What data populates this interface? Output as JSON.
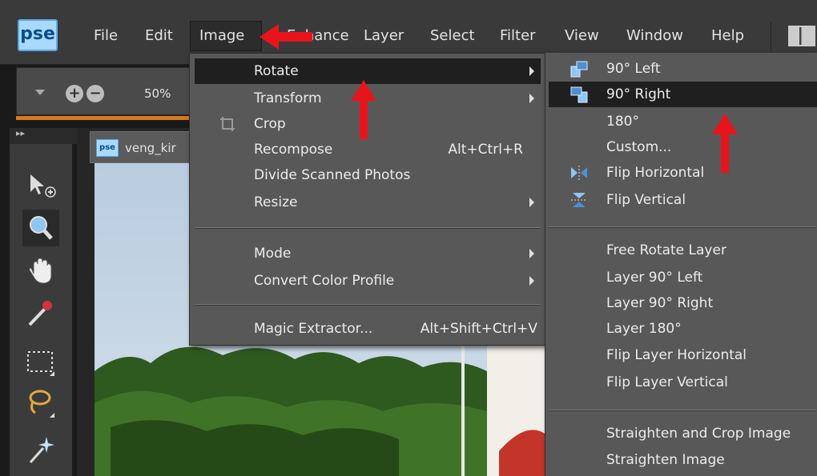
{
  "app": {
    "logo": "pse"
  },
  "menubar": {
    "items": [
      "File",
      "Edit",
      "Image",
      "Enhance",
      "Layer",
      "Select",
      "Filter",
      "View",
      "Window",
      "Help"
    ]
  },
  "options": {
    "zoom": "50%"
  },
  "document": {
    "tab_logo": "pse",
    "filename": "veng_kir"
  },
  "image_menu": {
    "items": [
      {
        "label": "Rotate",
        "submenu": true,
        "highlighted": true
      },
      {
        "label": "Transform",
        "submenu": true
      },
      {
        "label": "Crop",
        "icon": "crop-icon"
      },
      {
        "label": "Recompose",
        "shortcut": "Alt+Ctrl+R"
      },
      {
        "label": "Divide Scanned Photos"
      },
      {
        "label": "Resize",
        "submenu": true
      },
      {
        "label": "Mode",
        "submenu": true
      },
      {
        "label": "Convert Color Profile",
        "submenu": true
      },
      {
        "label": "Magic Extractor...",
        "shortcut": "Alt+Shift+Ctrl+V"
      }
    ]
  },
  "rotate_menu": {
    "items": [
      {
        "label": "90° Left",
        "icon": "rotate-left-icon"
      },
      {
        "label": "90° Right",
        "icon": "rotate-right-icon",
        "highlighted": true
      },
      {
        "label": "180°"
      },
      {
        "label": "Custom..."
      },
      {
        "label": "Flip Horizontal",
        "icon": "flip-horizontal-icon"
      },
      {
        "label": "Flip Vertical",
        "icon": "flip-vertical-icon"
      },
      {
        "label": "Free Rotate Layer"
      },
      {
        "label": "Layer 90° Left"
      },
      {
        "label": "Layer 90° Right"
      },
      {
        "label": "Layer 180°"
      },
      {
        "label": "Flip Layer Horizontal"
      },
      {
        "label": "Flip Layer Vertical"
      },
      {
        "label": "Straighten and Crop Image"
      },
      {
        "label": "Straighten Image"
      }
    ]
  },
  "colors": {
    "highlight": "#1f1f1f",
    "menu_bg": "#585858",
    "annotation_arrow": "#e8141b",
    "options_accent": "#d57a1d"
  }
}
